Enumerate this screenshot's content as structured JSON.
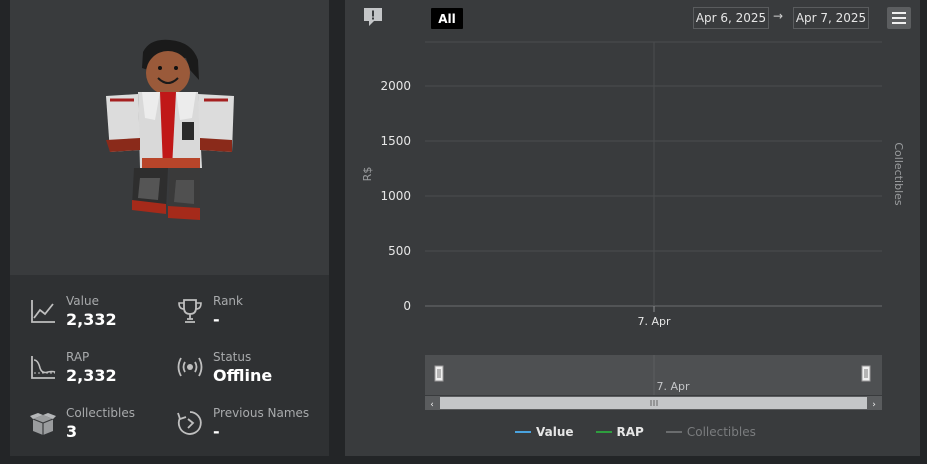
{
  "profile": {
    "stats": [
      {
        "label": "Value",
        "value": "2,332",
        "icon": "line-chart-icon"
      },
      {
        "label": "Rank",
        "value": "-",
        "icon": "trophy-icon"
      },
      {
        "label": "RAP",
        "value": "2,332",
        "icon": "rap-chart-icon"
      },
      {
        "label": "Status",
        "value": "Offline",
        "icon": "broadcast-icon"
      },
      {
        "label": "Collectibles",
        "value": "3",
        "icon": "box-icon"
      },
      {
        "label": "Previous Names",
        "value": "-",
        "icon": "history-icon"
      }
    ]
  },
  "chart_toolbar": {
    "range_all": "All",
    "date_from": "Apr 6, 2025",
    "arrow": "→",
    "date_to": "Apr 7, 2025"
  },
  "chart_data": {
    "type": "line",
    "y_ticks": [
      "2000",
      "1500",
      "1000",
      "500",
      "0"
    ],
    "ylim": [
      0,
      2400
    ],
    "ylabel": "R$",
    "ylabel_right": "Collectibles",
    "x_ticks": [
      "7. Apr"
    ],
    "navigator_tick": "7. Apr",
    "series": [
      {
        "name": "Value",
        "color": "#4aa3df",
        "values": []
      },
      {
        "name": "RAP",
        "color": "#2e9e3e",
        "values": []
      },
      {
        "name": "Collectibles",
        "color": "#6a6c6e",
        "values": []
      }
    ],
    "grid": true
  }
}
